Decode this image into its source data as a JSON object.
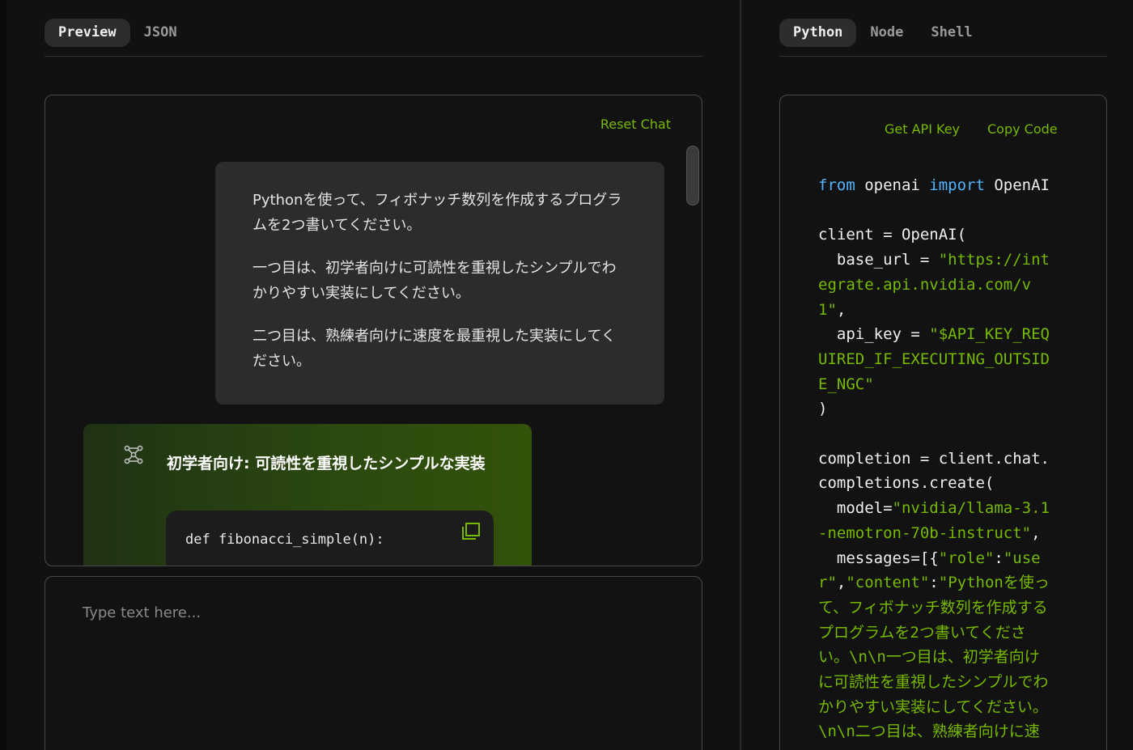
{
  "preview_tabs": [
    {
      "label": "Preview",
      "active": true
    },
    {
      "label": "JSON",
      "active": false
    }
  ],
  "code_tabs": [
    {
      "label": "Python",
      "active": true
    },
    {
      "label": "Node",
      "active": false
    },
    {
      "label": "Shell",
      "active": false
    }
  ],
  "chat": {
    "reset_label": "Reset Chat",
    "user_message": [
      "Pythonを使って、フィボナッチ数列を作成するプログラムを2つ書いてください。",
      "一つ目は、初学者向けに可読性を重視したシンプルでわかりやすい実装にしてください。",
      "二つ目は、熟練者向けに速度を最重視した実装にしてください。"
    ],
    "bot_title": "初学者向け: 可読性を重視したシンプルな実装",
    "code_first_line": "def fibonacci_simple(n):"
  },
  "input": {
    "placeholder": "Type text here..."
  },
  "code_panel": {
    "get_api_key_label": "Get API Key",
    "copy_code_label": "Copy Code",
    "snippet": {
      "kw_from": "from",
      "module": " openai ",
      "kw_import": "import",
      "cls": " OpenAI",
      "client_open": "client = OpenAI(",
      "base_url_key": "  base_url = ",
      "base_url_val_1": "\"https://int",
      "base_url_val_2": "egrate.api.nvidia.com/v",
      "base_url_val_3": "1\"",
      "comma": ",",
      "api_key_key": "  api_key = ",
      "api_key_val_1": "\"$API_KEY_REQ",
      "api_key_val_2": "UIRED_IF_EXECUTING_OUTSID",
      "api_key_val_3": "E_NGC\"",
      "close_paren": ")",
      "completion_1": "completion = client.chat.",
      "completion_2": "completions.create(",
      "model_key": "  model=",
      "model_val_1": "\"nvidia/llama-3.1",
      "model_val_2": "-nemotron-70b-instruct\"",
      "messages_key": "  messages=[{",
      "role_key": "\"role\"",
      "colon": ":",
      "role_val_1": "\"use",
      "role_val_2": "r\"",
      "content_key": "\"content\"",
      "content_val_1": "\"Pythonを使っ",
      "content_val_2": "て、フィボナッチ数列を作成する",
      "content_val_3": "プログラムを2つ書いてくださ",
      "content_val_4": "い。\\n\\n一つ目は、初学者向け",
      "content_val_5": "に可読性を重視したシンプルでわ",
      "content_val_6": "かりやすい実装にしてください。",
      "content_val_7": "\\n\\n二つ目は、熟練者向けに速"
    }
  }
}
